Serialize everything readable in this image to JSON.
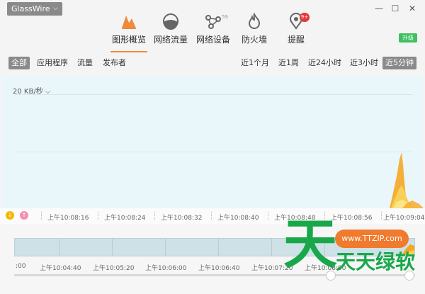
{
  "app": {
    "name": "GlassWire",
    "menu_caret": "⌵"
  },
  "window_controls": {
    "minimize": "—",
    "maximize": "☐",
    "close": "✕"
  },
  "nav": {
    "items": [
      {
        "label": "图形概览",
        "icon": "graph-icon",
        "active": true
      },
      {
        "label": "网络流量",
        "icon": "traffic-icon"
      },
      {
        "label": "网络设备",
        "icon": "devices-icon",
        "badge": "59"
      },
      {
        "label": "防火墙",
        "icon": "firewall-icon"
      },
      {
        "label": "提醒",
        "icon": "alerts-icon",
        "badge": "9+"
      }
    ],
    "upgrade_label": "升级"
  },
  "filters": {
    "left": [
      "全部",
      "应用程序",
      "流量",
      "发布者"
    ],
    "right": [
      "近1个月",
      "近1周",
      "近24小时",
      "近3小时",
      "近5分钟"
    ],
    "left_selected": "全部",
    "right_selected": "近5分钟"
  },
  "graph": {
    "scale_label": "20 KB/秒",
    "scale_caret": "⌵"
  },
  "time_axis": {
    "ticks": [
      "上午10:08:16",
      "上午10:08:24",
      "上午10:08:32",
      "上午10:08:40",
      "上午10:08:48",
      "上午10:08:56",
      "上午10:09:04"
    ]
  },
  "timeline": {
    "ticks": [
      ":00",
      "上午10:04:40",
      "上午10:05:20",
      "上午10:06:00",
      "上午10:06:40",
      "上午10:07:20",
      "上午10:08:00"
    ]
  },
  "watermark": {
    "big_char": "天",
    "url": "www.TTZIP.com",
    "text": "天天绿软"
  },
  "colors": {
    "accent": "#f08a3c",
    "graph_bg": "#eaf7fa",
    "incoming": "#f5a623",
    "outgoing": "#f7d155",
    "upgrade": "#3fbf5f",
    "watermark_green": "#18a84a"
  }
}
